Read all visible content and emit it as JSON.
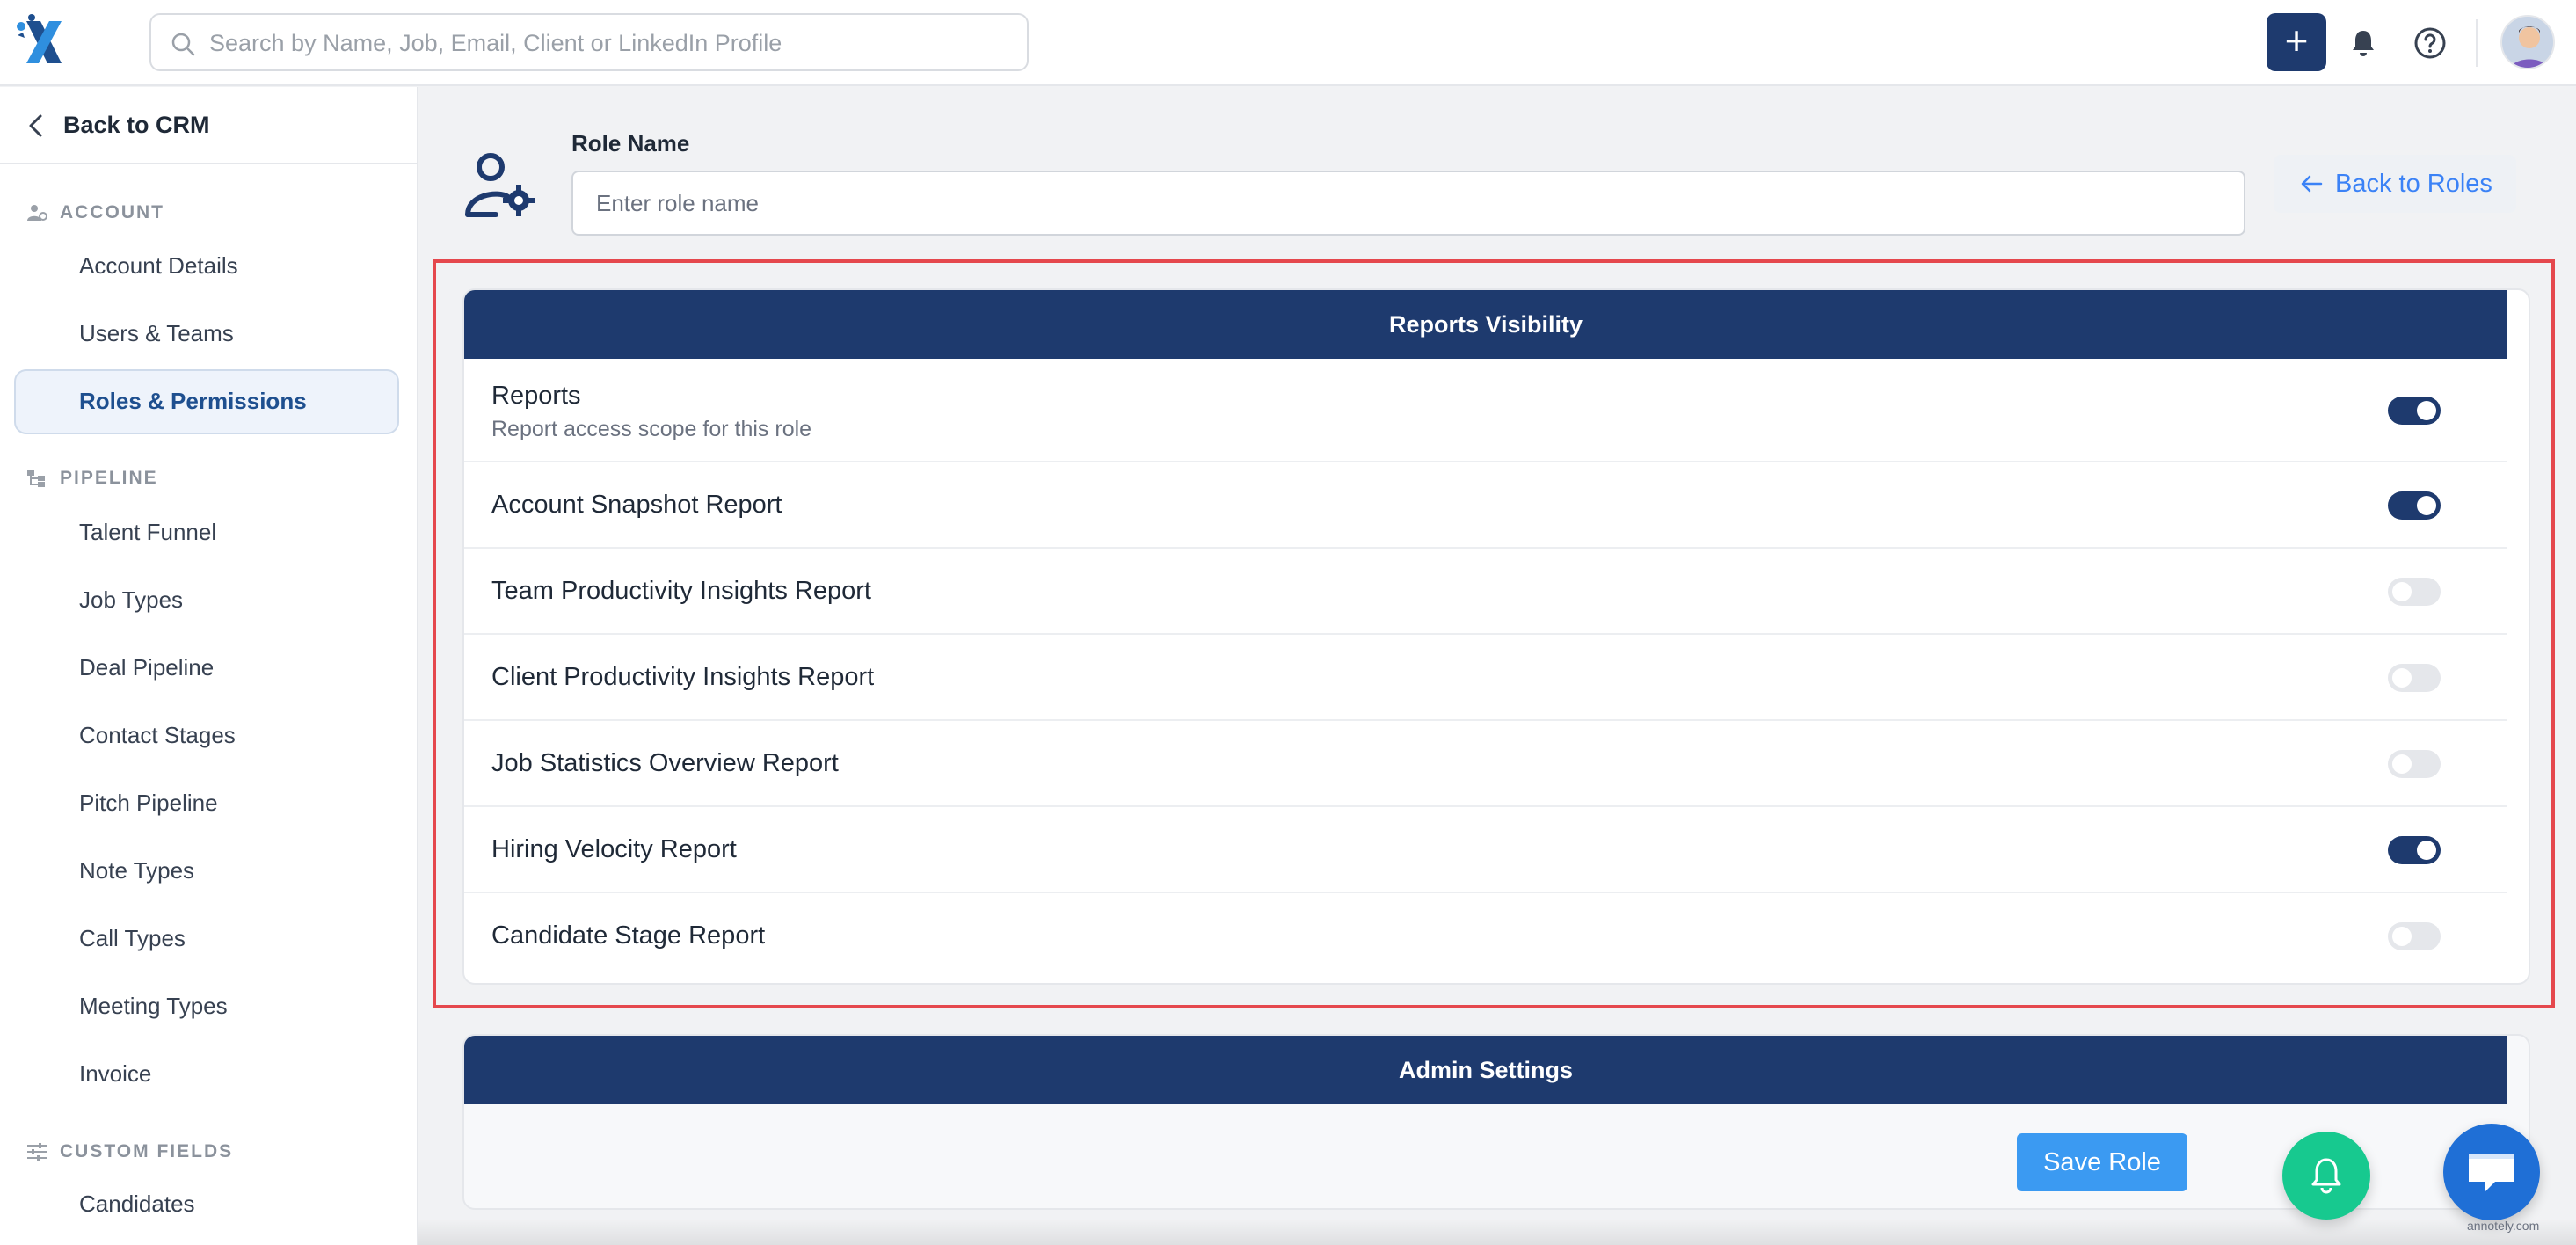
{
  "header": {
    "search_placeholder": "Search by Name, Job, Email, Client or LinkedIn Profile",
    "add_label": "+"
  },
  "sidebar": {
    "back_label": "Back to CRM",
    "sections": [
      {
        "title": "ACCOUNT",
        "items": [
          "Account Details",
          "Users & Teams",
          "Roles & Permissions"
        ]
      },
      {
        "title": "PIPELINE",
        "items": [
          "Talent Funnel",
          "Job Types",
          "Deal Pipeline",
          "Contact Stages",
          "Pitch Pipeline",
          "Note Types",
          "Call Types",
          "Meeting Types",
          "Invoice"
        ]
      },
      {
        "title": "CUSTOM FIELDS",
        "items": [
          "Candidates"
        ]
      }
    ],
    "active_item": "Roles & Permissions"
  },
  "main": {
    "role_name_label": "Role Name",
    "role_name_placeholder": "Enter role name",
    "role_name_value": "",
    "back_to_roles_label": "Back to Roles",
    "reports_card": {
      "title": "Reports Visibility",
      "rows": [
        {
          "label": "Reports",
          "description": "Report access scope for this role",
          "enabled": true
        },
        {
          "label": "Account Snapshot Report",
          "enabled": true
        },
        {
          "label": "Team Productivity Insights Report",
          "enabled": false
        },
        {
          "label": "Client Productivity Insights Report",
          "enabled": false
        },
        {
          "label": "Job Statistics Overview Report",
          "enabled": false
        },
        {
          "label": "Hiring Velocity Report",
          "enabled": true
        },
        {
          "label": "Candidate Stage Report",
          "enabled": false
        }
      ]
    },
    "admin_card": {
      "title": "Admin Settings"
    },
    "save_label": "Save Role"
  },
  "watermark": "annotely.com",
  "colors": {
    "navy": "#1e3a6e",
    "accent_blue": "#3b82f6",
    "save_blue": "#3b9af2",
    "fab_green": "#17c98f",
    "fab_blue": "#1f6fd6",
    "highlight_red": "#e5484d"
  }
}
